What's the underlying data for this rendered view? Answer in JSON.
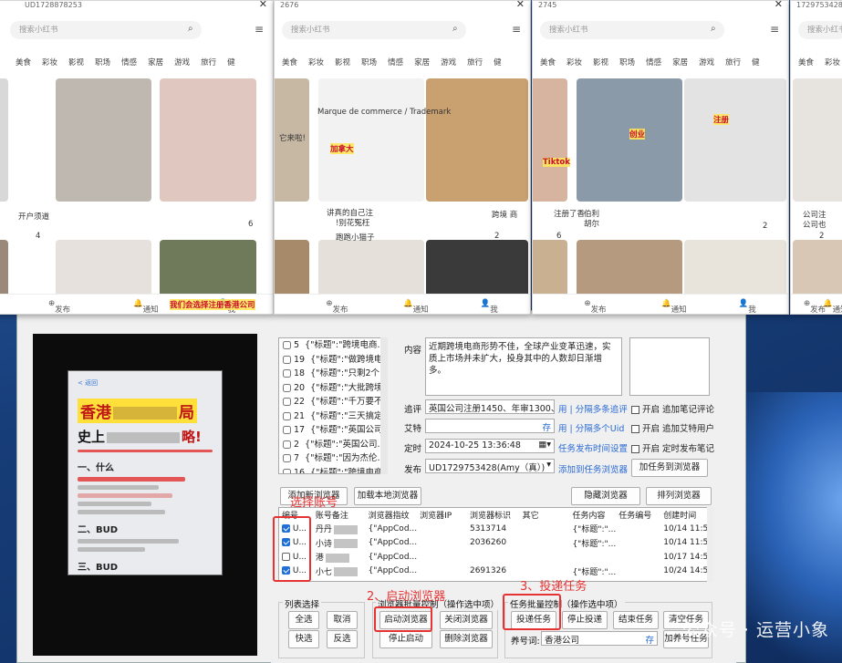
{
  "phones": [
    {
      "title": "UD1728878253",
      "search_placeholder": "搜索小红书",
      "categories": [
        "美食",
        "彩妆",
        "影视",
        "职场",
        "情感",
        "家居",
        "游戏",
        "旅行",
        "健"
      ]
    },
    {
      "title": "2676",
      "search_placeholder": "搜索小红书",
      "categories": [
        "美食",
        "彩妆",
        "影视",
        "职场",
        "情感",
        "家居",
        "游戏",
        "旅行",
        "健"
      ]
    },
    {
      "title": "2745",
      "search_placeholder": "搜索小红书",
      "categories": [
        "美食",
        "彩妆",
        "影视",
        "职场",
        "情感",
        "家居",
        "游戏",
        "旅行",
        "健"
      ]
    },
    {
      "title": "1729753428",
      "search_placeholder": "搜索小红书",
      "categories": [
        "美食",
        "彩妆",
        "影视"
      ]
    }
  ],
  "phone_nav": {
    "publish": "发布",
    "notify": "通知",
    "me": "我"
  },
  "feed_text": {
    "p1_caption": "开户须道",
    "p1_likes": "4",
    "p1_likes2": "6",
    "p1_banner": "我们会选择注册香港公司",
    "p2_caption1": "它来啦!",
    "p2_caption2": "讲真的自己注",
    "p2_caption3": "!别花冤枉",
    "p2_caption4": "跨境 商",
    "p2_author": "跑跑小猫子",
    "p2_likes": "2",
    "p2_likes2": "2",
    "p2_card_title": "Marque de commerce / Trademark",
    "p2_card_red": "加拿大",
    "p3_caption1": "注册了香",
    "p3_caption2": "伯利",
    "p3_caption3": "胡尔",
    "p3_likes": "6",
    "p3_likes2": "2",
    "p3_card_word": "创业",
    "p3_tiktok": "Tiktok",
    "p4_caption": "公司注",
    "p4_caption2": "公司也",
    "p4_likes": "2",
    "p4_banner": "注册"
  },
  "preview": {
    "nav": "< 返回",
    "title1": "香港",
    "title1b": "局",
    "title2": "史上",
    "title2b": "略!",
    "s1": "一、什么",
    "s2": "二、BUD",
    "s3": "三、BUD"
  },
  "tasks": [
    {
      "no": "5",
      "text": "{\"标题\":\"跨境电商..."
    },
    {
      "no": "19",
      "text": "{\"标题\":\"做跨境电..."
    },
    {
      "no": "18",
      "text": "{\"标题\":\"只剩2个..."
    },
    {
      "no": "20",
      "text": "{\"标题\":\"大批跨境..."
    },
    {
      "no": "22",
      "text": "{\"标题\":\"千万要不..."
    },
    {
      "no": "21",
      "text": "{\"标题\":\"三天搞定..."
    },
    {
      "no": "17",
      "text": "{\"标题\":\"英国公司..."
    },
    {
      "no": "2",
      "text": "{\"标题\":\"英国公司..."
    },
    {
      "no": "7",
      "text": "{\"标题\":\"因为杰伦..."
    },
    {
      "no": "16",
      "text": "{\"标题\":\"跨境电商..."
    }
  ],
  "form": {
    "content_label": "内容",
    "content_value": "近期跨境电商形势不佳，全球产业变革迅速，实质上市场并未扩大，投身其中的人数却日渐增多。",
    "comment_label": "追评",
    "comment_value": "英国公司注册1450、年审1300、存",
    "comment_link": "用 | 分隔多条追评",
    "comment_chk": "开启 追加笔记评论",
    "cue_label": "艾特",
    "cue_btn": "存",
    "cue_link": "用 | 分隔多个Uid",
    "cue_chk": "开启 追加艾特用户",
    "time_label": "定时",
    "time_value": "2024-10-25 13:36:48",
    "time_link": "任务发布时间设置",
    "time_chk": "开启 定时发布笔记",
    "publish_label": "发布",
    "publish_value": "UD1729753428(Amy（真）)",
    "publish_link": "添加到任务浏览器",
    "publish_btn": "加任务到浏览器"
  },
  "buttons": {
    "add_new": "添加新浏览器",
    "add_local": "加载本地浏览器",
    "hide": "隐藏浏览器",
    "arrange": "排列浏览器"
  },
  "grid": {
    "headers": [
      "编号",
      "账号备注",
      "浏览器指纹",
      "浏览器IP",
      "浏览器标识",
      "其它",
      "任务内容",
      "任务编号",
      "创建时间"
    ],
    "rows": [
      {
        "checked": true,
        "id": "U...",
        "note": "丹丹",
        "fp": "{\"AppCod...",
        "ip": "",
        "mark": "5313714",
        "other": "",
        "task": "{\"标题\":\"...",
        "taskno": "",
        "time": "10/14 11:54"
      },
      {
        "checked": true,
        "id": "U...",
        "note": "小诗",
        "fp": "{\"AppCod...",
        "ip": "",
        "mark": "2036260",
        "other": "",
        "task": "{\"标题\":\"...",
        "taskno": "",
        "time": "10/14 11:57"
      },
      {
        "checked": false,
        "id": "U...",
        "note": "港",
        "fp": "{\"AppCod...",
        "ip": "",
        "mark": "",
        "other": "",
        "task": "",
        "taskno": "",
        "time": "10/17 14:54"
      },
      {
        "checked": true,
        "id": "U...",
        "note": "小七",
        "fp": "{\"AppCod...",
        "ip": "",
        "mark": "2691326",
        "other": "",
        "task": "{\"标题\":\"...",
        "taskno": "",
        "time": "10/24 14:51"
      }
    ]
  },
  "groups": {
    "list_title": "列表选择",
    "select_all": "全选",
    "cancel": "取消",
    "quick": "快选",
    "invert": "反选",
    "browser_title": "浏览器批量控制（操作选中项）",
    "start": "启动浏览器",
    "close": "关闭浏览器",
    "stop_start": "停止启动",
    "delete": "删除浏览器",
    "task_title": "任务批量控制（操作选中项）",
    "deliver": "投递任务",
    "stop_deliver": "停止投递",
    "end_task": "结束任务",
    "clear_task": "清空任务",
    "raise_label": "养号词:",
    "raise_value": "香港公司",
    "raise_store": "存",
    "raise_btn": "加养号任务"
  },
  "annotations": {
    "select_account": "选择账号",
    "start_browser": "2、启动浏览器",
    "deliver_task": "3、投递任务"
  },
  "watermark": "公众号 · 运营小象",
  "colors": {
    "accent_red": "#e53333",
    "link_blue": "#2a6ad6",
    "check_blue": "#1f6fd6",
    "banner_yellow": "#ffe03a"
  }
}
